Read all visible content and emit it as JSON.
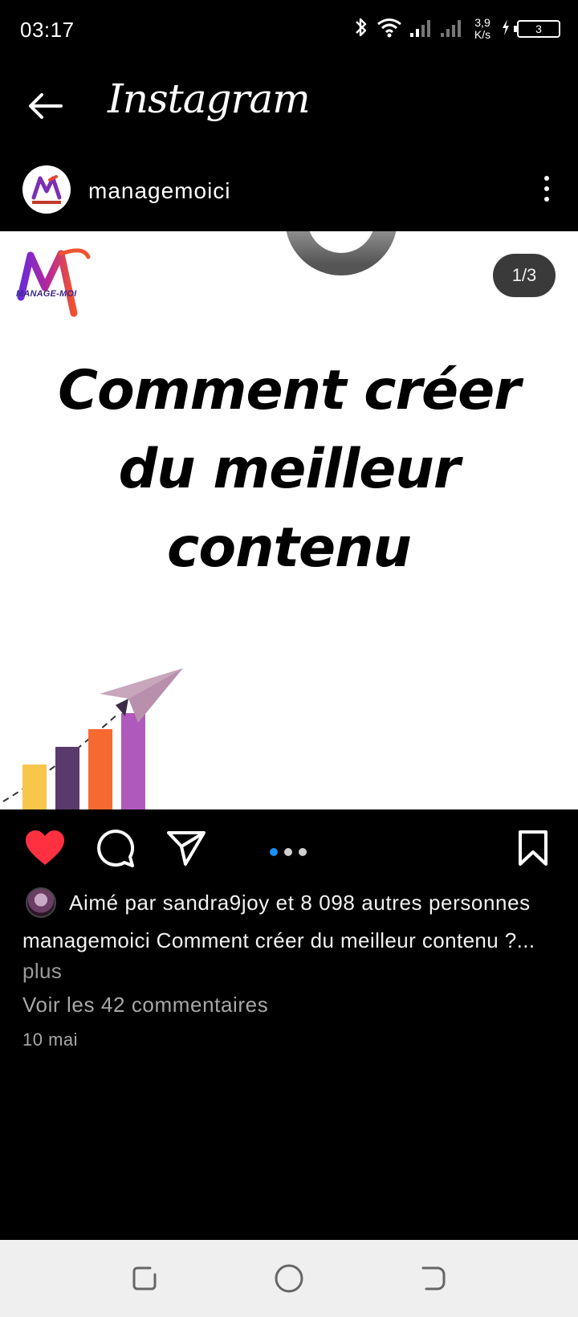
{
  "status_bar": {
    "time": "03:17",
    "speed_value": "3,9",
    "speed_unit": "K/s",
    "battery": "3"
  },
  "header": {
    "title": "Instagram"
  },
  "post": {
    "username": "managemoici",
    "logo_text": "MANAGE-MOI",
    "counter": "1/3",
    "headline": [
      "Comment créer",
      "du meilleur",
      "contenu"
    ],
    "carousel": {
      "current": 1,
      "total": 3
    },
    "liked": true
  },
  "likes": {
    "text": "Aimé par sandra9joy et 8 098 autres personnes"
  },
  "caption": {
    "username": "managemoici",
    "text": "Comment créer du meilleur contenu ?...",
    "more_label": "plus"
  },
  "comments_link": "Voir les 42 commentaires",
  "date": "10 mai",
  "colors": {
    "like_red": "#ff3040",
    "dot_blue": "#1c8ef2"
  }
}
